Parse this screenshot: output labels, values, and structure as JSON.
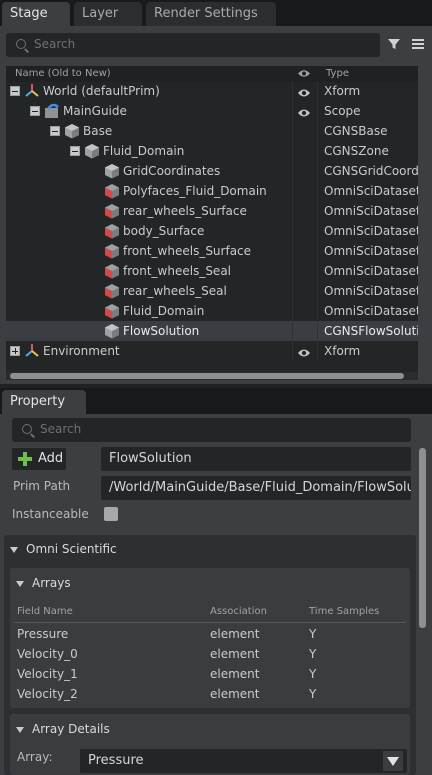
{
  "stage_tabs": [
    {
      "label": "Stage",
      "active": true
    },
    {
      "label": "Layer",
      "active": false
    },
    {
      "label": "Render Settings",
      "active": false
    }
  ],
  "stage_search": {
    "placeholder": "Search"
  },
  "tree_header": {
    "name": "Name (Old to New)",
    "type": "Type"
  },
  "tree_rows": [
    {
      "name": "World (defaultPrim)",
      "type": "Xform",
      "icon": "xform-icon",
      "expander": "minus",
      "eye": true
    },
    {
      "name": "MainGuide",
      "type": "Scope",
      "icon": "scope-icon",
      "expander": "minus",
      "eye": true
    },
    {
      "name": "Base",
      "type": "CGNSBase",
      "icon": "cube-icon",
      "expander": "minus",
      "eye": false
    },
    {
      "name": "Fluid_Domain",
      "type": "CGNSZone",
      "icon": "cube-icon",
      "expander": "minus",
      "eye": false
    },
    {
      "name": "GridCoordinates",
      "type": "CGNSGridCoord",
      "icon": "cube-icon",
      "expander": "",
      "eye": false
    },
    {
      "name": "Polyfaces_Fluid_Domain",
      "type": "OmniSciDataset",
      "icon": "dataset-icon",
      "expander": "",
      "eye": false
    },
    {
      "name": "rear_wheels_Surface",
      "type": "OmniSciDataset",
      "icon": "dataset-icon",
      "expander": "",
      "eye": false
    },
    {
      "name": "body_Surface",
      "type": "OmniSciDataset",
      "icon": "dataset-icon",
      "expander": "",
      "eye": false
    },
    {
      "name": "front_wheels_Surface",
      "type": "OmniSciDataset",
      "icon": "dataset-icon",
      "expander": "",
      "eye": false
    },
    {
      "name": "front_wheels_Seal",
      "type": "OmniSciDataset",
      "icon": "dataset-icon",
      "expander": "",
      "eye": false
    },
    {
      "name": "rear_wheels_Seal",
      "type": "OmniSciDataset",
      "icon": "dataset-icon",
      "expander": "",
      "eye": false
    },
    {
      "name": "Fluid_Domain",
      "type": "OmniSciDataset",
      "icon": "dataset-icon",
      "expander": "",
      "eye": false
    },
    {
      "name": "FlowSolution",
      "type": "CGNSFlowSoluti",
      "icon": "cube-icon",
      "expander": "",
      "eye": false,
      "selected": true
    },
    {
      "name": "Environment",
      "type": "Xform",
      "icon": "xform-icon",
      "expander": "plus",
      "eye": true
    }
  ],
  "property_tab": {
    "label": "Property"
  },
  "property_search": {
    "placeholder": "Search"
  },
  "add_button": {
    "label": "Add"
  },
  "prim_name": "FlowSolution",
  "prim_path": {
    "label": "Prim Path",
    "value": "/World/MainGuide/Base/Fluid_Domain/FlowSolution"
  },
  "instanceable": {
    "label": "Instanceable"
  },
  "omni_section": {
    "title": "Omni Scientific"
  },
  "arrays": {
    "title": "Arrays",
    "columns": [
      "Field Name",
      "Association",
      "Time Samples"
    ],
    "rows": [
      [
        "Pressure",
        "element",
        "Y"
      ],
      [
        "Velocity_0",
        "element",
        "Y"
      ],
      [
        "Velocity_1",
        "element",
        "Y"
      ],
      [
        "Velocity_2",
        "element",
        "Y"
      ]
    ]
  },
  "array_details": {
    "title": "Array Details",
    "array_label": "Array:",
    "array_value": "Pressure"
  }
}
